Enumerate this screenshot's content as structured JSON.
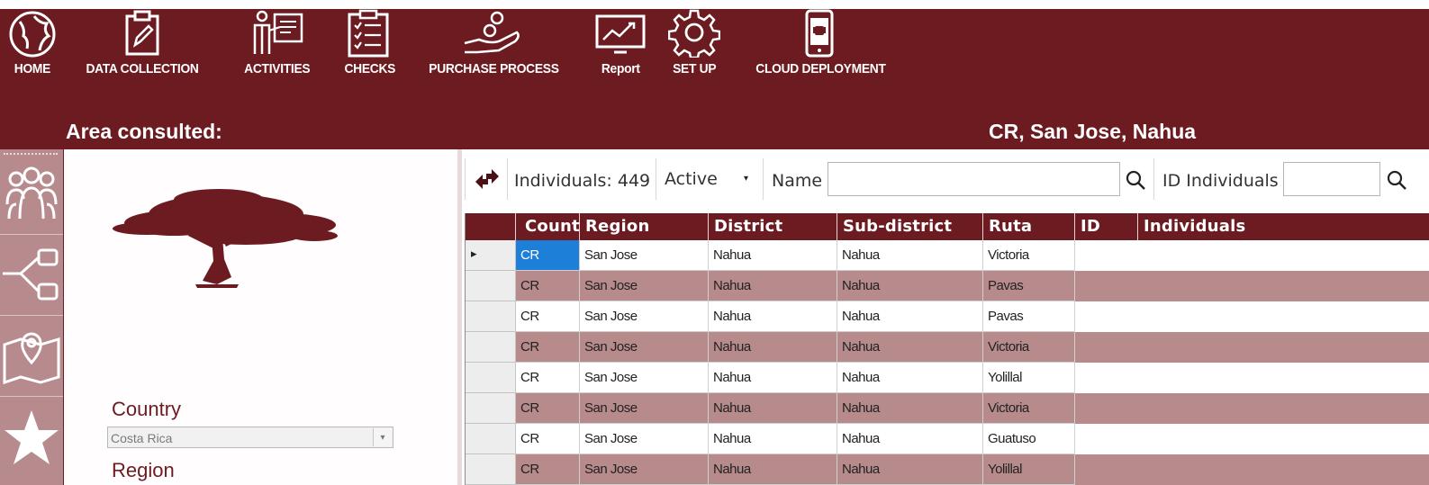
{
  "toolbar": {
    "items": [
      {
        "label": "HOME",
        "icon": "globe-icon"
      },
      {
        "label": "DATA COLLECTION",
        "icon": "clipboard-pen-icon"
      },
      {
        "label": "ACTIVITIES",
        "icon": "presenter-icon"
      },
      {
        "label": "CHECKS",
        "icon": "checklist-icon"
      },
      {
        "label": "PURCHASE PROCESS",
        "icon": "hand-coins-icon"
      },
      {
        "label": "Report",
        "icon": "chart-monitor-icon"
      },
      {
        "label": "SET UP",
        "icon": "gear-icon"
      },
      {
        "label": "CLOUD DEPLOYMENT",
        "icon": "android-phone-icon"
      }
    ]
  },
  "area": {
    "label": "Area consulted:",
    "value": "CR, San Jose, Nahua"
  },
  "left_rail": {
    "icons": [
      "people-group-icon",
      "hierarchy-icon",
      "map-pin-icon",
      "star-icon"
    ]
  },
  "form": {
    "country_label": "Country",
    "country_value": "Costa Rica",
    "region_label": "Region"
  },
  "filters": {
    "individuals_count": "Individuals: 449",
    "status_value": "Active",
    "name_label": "Name",
    "name_value": "",
    "id_label": "ID Individuals",
    "id_value": ""
  },
  "grid": {
    "columns": [
      "Count",
      "Region",
      "District",
      "Sub-district",
      "Ruta",
      "ID",
      "Individuals"
    ],
    "rows": [
      [
        "CR",
        "San Jose",
        "Nahua",
        "Nahua",
        "Victoria"
      ],
      [
        "CR",
        "San Jose",
        "Nahua",
        "Nahua",
        "Pavas"
      ],
      [
        "CR",
        "San Jose",
        "Nahua",
        "Nahua",
        "Pavas"
      ],
      [
        "CR",
        "San Jose",
        "Nahua",
        "Nahua",
        "Victoria"
      ],
      [
        "CR",
        "San Jose",
        "Nahua",
        "Nahua",
        "Yolillal"
      ],
      [
        "CR",
        "San Jose",
        "Nahua",
        "Nahua",
        "Victoria"
      ],
      [
        "CR",
        "San Jose",
        "Nahua",
        "Nahua",
        "Guatuso"
      ],
      [
        "CR",
        "San Jose",
        "Nahua",
        "Nahua",
        "Yolillal"
      ]
    ]
  },
  "colors": {
    "brand": "#6c1b20",
    "row_alt": "#b78a8b",
    "selection": "#1e7fd9"
  }
}
